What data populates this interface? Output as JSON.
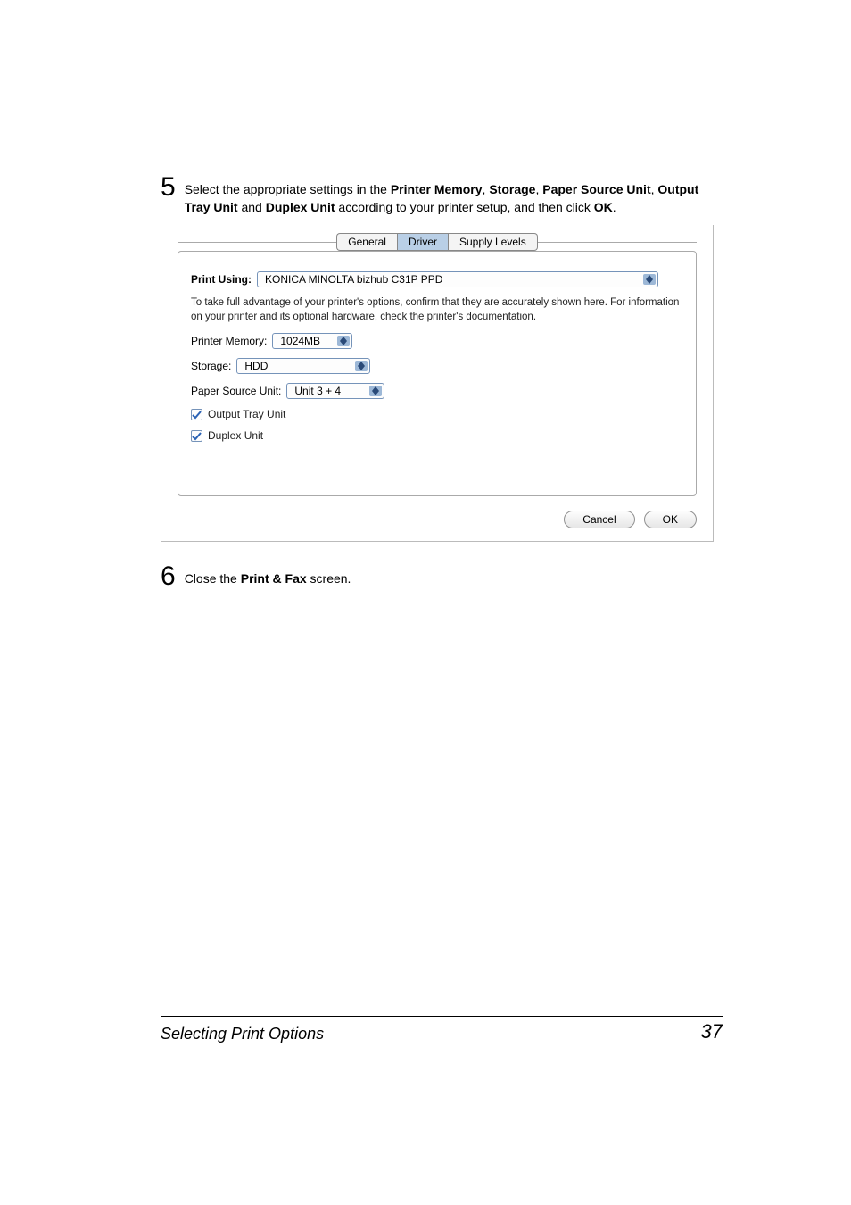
{
  "step5": {
    "num": "5",
    "pre": "Select the appropriate settings in the ",
    "b1": "Printer Memory",
    "sep1": ", ",
    "b2": "Storage",
    "sep2": ", ",
    "b3": "Paper Source Unit",
    "sep3": ", ",
    "b4": "Output Tray Unit",
    "sep4": " and ",
    "b5": "Duplex Unit",
    "mid": " according to your printer setup, and then click ",
    "b6": "OK",
    "end": "."
  },
  "dialog": {
    "tabs": {
      "general": "General",
      "driver": "Driver",
      "supply": "Supply Levels"
    },
    "print_using_label": "Print Using:",
    "print_using_value": "KONICA MINOLTA bizhub C31P PPD",
    "note": "To take full advantage of your printer's options, confirm that they are accurately shown here. For information on your printer and its optional hardware, check the printer's documentation.",
    "printer_memory_label": "Printer Memory:",
    "printer_memory_value": "1024MB",
    "storage_label": "Storage:",
    "storage_value": "HDD",
    "paper_source_label": "Paper Source Unit:",
    "paper_source_value": "Unit 3 + 4",
    "output_tray_label": "Output Tray Unit",
    "duplex_label": "Duplex Unit",
    "cancel": "Cancel",
    "ok": "OK"
  },
  "step6": {
    "num": "6",
    "pre": "Close the ",
    "b1": "Print & Fax",
    "end": " screen."
  },
  "footer": {
    "left": "Selecting Print Options",
    "right": "37"
  }
}
